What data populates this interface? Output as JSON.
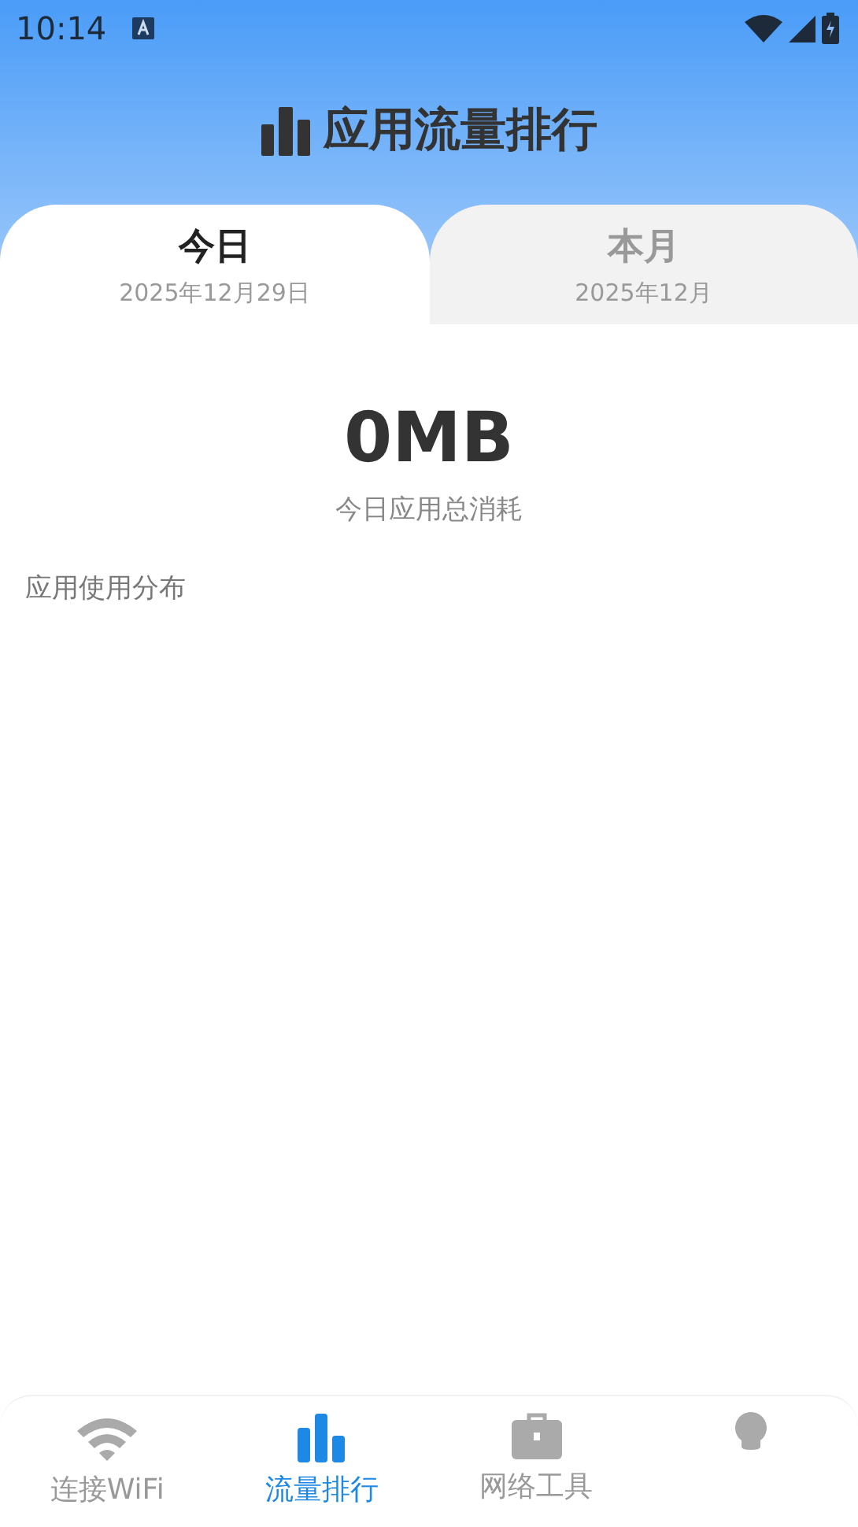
{
  "status_bar": {
    "time": "10:14"
  },
  "header": {
    "title": "应用流量排行"
  },
  "tabs": [
    {
      "label": "今日",
      "date": "2025年12月29日",
      "selected": true
    },
    {
      "label": "本月",
      "date": "2025年12月",
      "selected": false
    }
  ],
  "summary": {
    "value": "0MB",
    "caption": "今日应用总消耗"
  },
  "section": {
    "title": "应用使用分布"
  },
  "bottom_nav": [
    {
      "label": "连接WiFi",
      "selected": false
    },
    {
      "label": "流量排行",
      "selected": true
    },
    {
      "label": "网络工具",
      "selected": false
    },
    {
      "selected": false
    }
  ]
}
